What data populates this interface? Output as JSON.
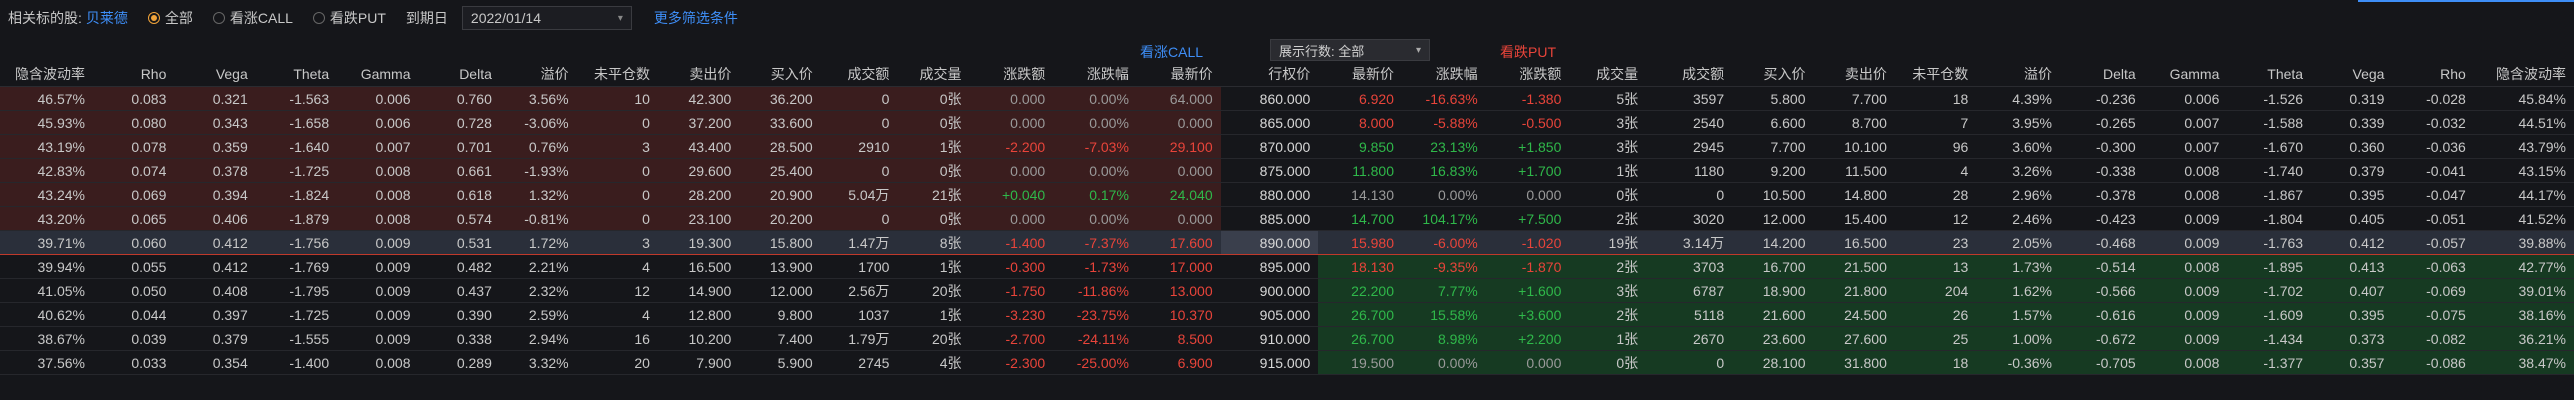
{
  "topbar": {
    "underlying_label": "相关标的股:",
    "underlying_name": "贝莱德",
    "filters": [
      {
        "label": "全部",
        "selected": true
      },
      {
        "label": "看涨CALL",
        "selected": false
      },
      {
        "label": "看跌PUT",
        "selected": false
      }
    ],
    "expiry_label": "到期日",
    "expiry_value": "2022/01/14",
    "more_filters": "更多筛选条件"
  },
  "section": {
    "call_title": "看涨CALL",
    "put_title": "看跌PUT",
    "rows_select": "展示行数: 全部"
  },
  "colors": {
    "up": "#e8443a",
    "down": "#2fb84a",
    "accent": "#3e8ef7",
    "radio": "#f0a33a"
  },
  "columns": [
    "隐含波动率",
    "Rho",
    "Vega",
    "Theta",
    "Gamma",
    "Delta",
    "溢价",
    "未平仓数",
    "卖出价",
    "买入价",
    "成交额",
    "成交量",
    "涨跌额",
    "涨跌幅",
    "最新价",
    "行权价",
    "最新价",
    "涨跌幅",
    "涨跌额",
    "成交量",
    "成交额",
    "买入价",
    "卖出价",
    "未平仓数",
    "溢价",
    "Delta",
    "Gamma",
    "Theta",
    "Vega",
    "Rho",
    "隐含波动率"
  ],
  "rows": [
    {
      "cells": [
        "46.57%",
        "0.083",
        "0.321",
        "-1.563",
        "0.006",
        "0.760",
        "3.56%",
        "10",
        "42.300",
        "36.200",
        "0",
        "0张",
        "0.000",
        "0.00%",
        "64.000",
        "860.000",
        "6.920",
        "-16.63%",
        "-1.380",
        "5张",
        "3597",
        "5.800",
        "7.700",
        "18",
        "4.39%",
        "-0.236",
        "0.006",
        "-1.526",
        "0.319",
        "-0.028",
        "45.84%"
      ],
      "dir": [
        "",
        "",
        "",
        "",
        "",
        "",
        "",
        "",
        "",
        "",
        "",
        "",
        "flat",
        "flat",
        "nodata",
        "",
        "up",
        "up",
        "up",
        "",
        "",
        "",
        "",
        "",
        "",
        "",
        "",
        "",
        "",
        "",
        ""
      ]
    },
    {
      "cells": [
        "45.93%",
        "0.080",
        "0.343",
        "-1.658",
        "0.006",
        "0.728",
        "-3.06%",
        "0",
        "37.200",
        "33.600",
        "0",
        "0张",
        "0.000",
        "0.00%",
        "0.000",
        "865.000",
        "8.000",
        "-5.88%",
        "-0.500",
        "3张",
        "2540",
        "6.600",
        "8.700",
        "7",
        "3.95%",
        "-0.265",
        "0.007",
        "-1.588",
        "0.339",
        "-0.032",
        "44.51%"
      ],
      "dir": [
        "",
        "",
        "",
        "",
        "",
        "",
        "",
        "",
        "",
        "",
        "",
        "",
        "flat",
        "flat",
        "nodata",
        "",
        "up",
        "up",
        "up",
        "",
        "",
        "",
        "",
        "",
        "",
        "",
        "",
        "",
        "",
        "",
        ""
      ]
    },
    {
      "cells": [
        "43.19%",
        "0.078",
        "0.359",
        "-1.640",
        "0.007",
        "0.701",
        "0.76%",
        "3",
        "43.400",
        "28.500",
        "2910",
        "1张",
        "-2.200",
        "-7.03%",
        "29.100",
        "870.000",
        "9.850",
        "23.13%",
        "+1.850",
        "3张",
        "2945",
        "7.700",
        "10.100",
        "96",
        "3.60%",
        "-0.300",
        "0.007",
        "-1.670",
        "0.360",
        "-0.036",
        "43.79%"
      ],
      "dir": [
        "",
        "",
        "",
        "",
        "",
        "",
        "",
        "",
        "",
        "",
        "",
        "",
        "up",
        "up",
        "up",
        "",
        "down",
        "down",
        "down",
        "",
        "",
        "",
        "",
        "",
        "",
        "",
        "",
        "",
        "",
        "",
        ""
      ]
    },
    {
      "cells": [
        "42.83%",
        "0.074",
        "0.378",
        "-1.725",
        "0.008",
        "0.661",
        "-1.93%",
        "0",
        "29.600",
        "25.400",
        "0",
        "0张",
        "0.000",
        "0.00%",
        "0.000",
        "875.000",
        "11.800",
        "16.83%",
        "+1.700",
        "1张",
        "1180",
        "9.200",
        "11.500",
        "4",
        "3.26%",
        "-0.338",
        "0.008",
        "-1.740",
        "0.379",
        "-0.041",
        "43.15%"
      ],
      "dir": [
        "",
        "",
        "",
        "",
        "",
        "",
        "",
        "",
        "",
        "",
        "",
        "",
        "flat",
        "flat",
        "nodata",
        "",
        "down",
        "down",
        "down",
        "",
        "",
        "",
        "",
        "",
        "",
        "",
        "",
        "",
        "",
        "",
        ""
      ]
    },
    {
      "cells": [
        "43.24%",
        "0.069",
        "0.394",
        "-1.824",
        "0.008",
        "0.618",
        "1.32%",
        "0",
        "28.200",
        "20.900",
        "5.04万",
        "21张",
        "+0.040",
        "0.17%",
        "24.040",
        "880.000",
        "14.130",
        "0.00%",
        "0.000",
        "0张",
        "0",
        "10.500",
        "14.800",
        "28",
        "2.96%",
        "-0.378",
        "0.008",
        "-1.867",
        "0.395",
        "-0.047",
        "44.17%"
      ],
      "dir": [
        "",
        "",
        "",
        "",
        "",
        "",
        "",
        "",
        "",
        "",
        "",
        "",
        "down",
        "down",
        "down",
        "",
        "nodata",
        "flat",
        "flat",
        "",
        "",
        "",
        "",
        "",
        "",
        "",
        "",
        "",
        "",
        "",
        ""
      ]
    },
    {
      "cells": [
        "43.20%",
        "0.065",
        "0.406",
        "-1.879",
        "0.008",
        "0.574",
        "-0.81%",
        "0",
        "23.100",
        "20.200",
        "0",
        "0张",
        "0.000",
        "0.00%",
        "0.000",
        "885.000",
        "14.700",
        "104.17%",
        "+7.500",
        "2张",
        "3020",
        "12.000",
        "15.400",
        "12",
        "2.46%",
        "-0.423",
        "0.009",
        "-1.804",
        "0.405",
        "-0.051",
        "41.52%"
      ],
      "dir": [
        "",
        "",
        "",
        "",
        "",
        "",
        "",
        "",
        "",
        "",
        "",
        "",
        "flat",
        "flat",
        "nodata",
        "",
        "down",
        "down",
        "down",
        "",
        "",
        "",
        "",
        "",
        "",
        "",
        "",
        "",
        "",
        "",
        ""
      ]
    },
    {
      "cells": [
        "39.71%",
        "0.060",
        "0.412",
        "-1.756",
        "0.009",
        "0.531",
        "1.72%",
        "3",
        "19.300",
        "15.800",
        "1.47万",
        "8张",
        "-1.400",
        "-7.37%",
        "17.600",
        "890.000",
        "15.980",
        "-6.00%",
        "-1.020",
        "19张",
        "3.14万",
        "14.200",
        "16.500",
        "23",
        "2.05%",
        "-0.468",
        "0.009",
        "-1.763",
        "0.412",
        "-0.057",
        "39.88%"
      ],
      "dir": [
        "",
        "",
        "",
        "",
        "",
        "",
        "",
        "",
        "",
        "",
        "",
        "",
        "up",
        "up",
        "up",
        "",
        "up",
        "up",
        "up",
        "",
        "",
        "",
        "",
        "",
        "",
        "",
        "",
        "",
        "",
        "",
        ""
      ]
    },
    {
      "cells": [
        "39.94%",
        "0.055",
        "0.412",
        "-1.769",
        "0.009",
        "0.482",
        "2.21%",
        "4",
        "16.500",
        "13.900",
        "1700",
        "1张",
        "-0.300",
        "-1.73%",
        "17.000",
        "895.000",
        "18.130",
        "-9.35%",
        "-1.870",
        "2张",
        "3703",
        "16.700",
        "21.500",
        "13",
        "1.73%",
        "-0.514",
        "0.008",
        "-1.895",
        "0.413",
        "-0.063",
        "42.77%"
      ],
      "dir": [
        "",
        "",
        "",
        "",
        "",
        "",
        "",
        "",
        "",
        "",
        "",
        "",
        "up",
        "up",
        "up",
        "",
        "up",
        "up",
        "up",
        "",
        "",
        "",
        "",
        "",
        "",
        "",
        "",
        "",
        "",
        "",
        ""
      ]
    },
    {
      "cells": [
        "41.05%",
        "0.050",
        "0.408",
        "-1.795",
        "0.009",
        "0.437",
        "2.32%",
        "12",
        "14.900",
        "12.000",
        "2.56万",
        "20张",
        "-1.750",
        "-11.86%",
        "13.000",
        "900.000",
        "22.200",
        "7.77%",
        "+1.600",
        "3张",
        "6787",
        "18.900",
        "21.800",
        "204",
        "1.62%",
        "-0.566",
        "0.009",
        "-1.702",
        "0.407",
        "-0.069",
        "39.01%"
      ],
      "dir": [
        "",
        "",
        "",
        "",
        "",
        "",
        "",
        "",
        "",
        "",
        "",
        "",
        "up",
        "up",
        "up",
        "",
        "down",
        "down",
        "down",
        "",
        "",
        "",
        "",
        "",
        "",
        "",
        "",
        "",
        "",
        "",
        ""
      ]
    },
    {
      "cells": [
        "40.62%",
        "0.044",
        "0.397",
        "-1.725",
        "0.009",
        "0.390",
        "2.59%",
        "4",
        "12.800",
        "9.800",
        "1037",
        "1张",
        "-3.230",
        "-23.75%",
        "10.370",
        "905.000",
        "26.700",
        "15.58%",
        "+3.600",
        "2张",
        "5118",
        "21.600",
        "24.500",
        "26",
        "1.57%",
        "-0.616",
        "0.009",
        "-1.609",
        "0.395",
        "-0.075",
        "38.16%"
      ],
      "dir": [
        "",
        "",
        "",
        "",
        "",
        "",
        "",
        "",
        "",
        "",
        "",
        "",
        "up",
        "up",
        "up",
        "",
        "down",
        "down",
        "down",
        "",
        "",
        "",
        "",
        "",
        "",
        "",
        "",
        "",
        "",
        "",
        ""
      ]
    },
    {
      "cells": [
        "38.67%",
        "0.039",
        "0.379",
        "-1.555",
        "0.009",
        "0.338",
        "2.94%",
        "16",
        "10.200",
        "7.400",
        "1.79万",
        "20张",
        "-2.700",
        "-24.11%",
        "8.500",
        "910.000",
        "26.700",
        "8.98%",
        "+2.200",
        "1张",
        "2670",
        "23.600",
        "27.600",
        "25",
        "1.00%",
        "-0.672",
        "0.009",
        "-1.434",
        "0.373",
        "-0.082",
        "36.21%"
      ],
      "dir": [
        "",
        "",
        "",
        "",
        "",
        "",
        "",
        "",
        "",
        "",
        "",
        "",
        "up",
        "up",
        "up",
        "",
        "down",
        "down",
        "down",
        "",
        "",
        "",
        "",
        "",
        "",
        "",
        "",
        "",
        "",
        "",
        ""
      ]
    },
    {
      "cells": [
        "37.56%",
        "0.033",
        "0.354",
        "-1.400",
        "0.008",
        "0.289",
        "3.32%",
        "20",
        "7.900",
        "5.900",
        "2745",
        "4张",
        "-2.300",
        "-25.00%",
        "6.900",
        "915.000",
        "19.500",
        "0.00%",
        "0.000",
        "0张",
        "0",
        "28.100",
        "31.800",
        "18",
        "-0.36%",
        "-0.705",
        "0.008",
        "-1.377",
        "0.357",
        "-0.086",
        "38.47%"
      ],
      "dir": [
        "",
        "",
        "",
        "",
        "",
        "",
        "",
        "",
        "",
        "",
        "",
        "",
        "up",
        "up",
        "up",
        "",
        "nodata",
        "flat",
        "flat",
        "",
        "",
        "",
        "",
        "",
        "",
        "",
        "",
        "",
        "",
        "",
        ""
      ]
    }
  ]
}
